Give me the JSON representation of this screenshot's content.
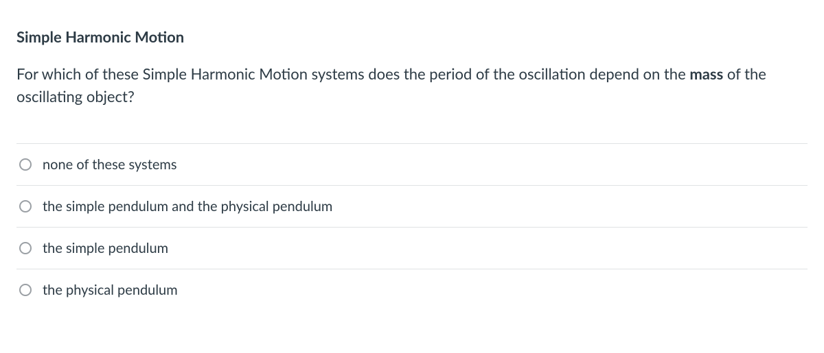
{
  "question": {
    "title": "Simple Harmonic Motion",
    "text_before": "For which of these Simple Harmonic Motion systems does the period of the oscillation depend on the ",
    "text_bold": "mass",
    "text_after": " of the oscillating object?"
  },
  "options": [
    {
      "label": "none of these systems"
    },
    {
      "label": "the simple pendulum and the physical pendulum"
    },
    {
      "label": "the simple pendulum"
    },
    {
      "label": "the physical pendulum"
    }
  ]
}
